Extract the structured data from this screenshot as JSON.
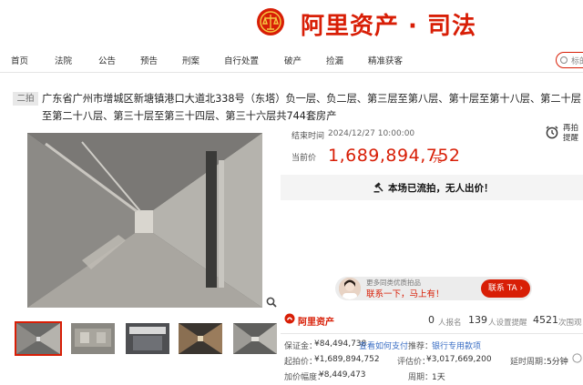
{
  "header": {
    "brand": "阿里资产 · 司法"
  },
  "nav": {
    "items": [
      "首页",
      "法院",
      "公告",
      "预告",
      "刑案",
      "自行处置",
      "破产",
      "捡漏",
      "精准获客"
    ]
  },
  "search": {
    "placeholder": "标的"
  },
  "listing": {
    "round": "二拍",
    "title": "广东省广州市增城区新塘镇港口大道北338号（东塔）负一层、负二层、第三层至第八层、第十层至第十八层、第二十层至第二十八层、第三十层至第三十四层、第三十六层共744套房产"
  },
  "auction": {
    "end_time_label": "结束时间",
    "end_time": "2024/12/27 10:00:00",
    "current_price_label": "当前价",
    "current_price": "1,689,894,752",
    "price_unit": "元",
    "remind": "再拍提醒",
    "status": "本场已流拍，无人出价！"
  },
  "contact": {
    "top_text": "更多同类优质拍品",
    "main_text": "联系一下，马上有！",
    "button": "联系 TA ›"
  },
  "stats": {
    "platform": "阿里资产",
    "signups": "0",
    "signups_label": "人报名",
    "reminders": "139",
    "reminders_label": "人设置提醒",
    "views": "4521",
    "views_label": "次围观"
  },
  "details": {
    "deposit_label": "保证金：",
    "deposit": "¥84,494,738",
    "how_to_pay": "查看如何支付",
    "recommend_label": "推荐：",
    "recommend": "银行专用款项",
    "start_price_label": "起拍价：",
    "start_price": "¥1,689,894,752",
    "appraisal_label": "评估价：",
    "appraisal": "¥3,017,669,200",
    "extension_label": "延时周期：",
    "extension": "5分钟",
    "increment_label": "加价幅度：",
    "increment": "¥8,449,473",
    "period_label": "周期：",
    "period": "1天"
  },
  "colors": {
    "brand_red": "#d81e06",
    "link_blue": "#3a6ec4"
  }
}
